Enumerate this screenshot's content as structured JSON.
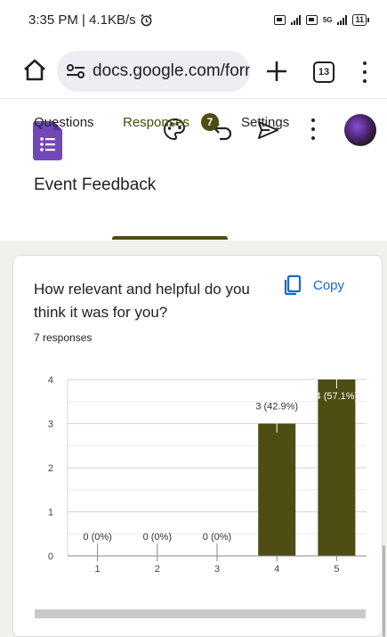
{
  "status_bar": {
    "time_speed": "3:35 PM | 4.1KB/s",
    "alarm_icon": "alarm-icon",
    "network_label": "5G",
    "battery": "11"
  },
  "browser": {
    "url": "docs.google.com/forr",
    "tab_count": "13",
    "icons": [
      "home-icon",
      "tune-icon",
      "plus-icon",
      "tabs-icon",
      "more-vert-icon"
    ]
  },
  "header": {
    "form_title": "Event Feedback",
    "icons": [
      "google-forms-icon",
      "palette-icon",
      "undo-icon",
      "send-icon",
      "more-vert-icon",
      "avatar"
    ],
    "tabs": [
      {
        "label": "Questions",
        "active": false
      },
      {
        "label": "Responses",
        "active": true
      },
      {
        "label": "Settings",
        "active": false
      }
    ],
    "responses_badge": "7",
    "accent_color": "#4d4d14"
  },
  "question_card": {
    "question": "How relevant and helpful do you think it was for you?",
    "copy_label": "Copy",
    "response_count": "7 responses"
  },
  "chart_data": {
    "type": "bar",
    "categories": [
      "1",
      "2",
      "3",
      "4",
      "5"
    ],
    "values": [
      0,
      0,
      0,
      3,
      4
    ],
    "data_labels": [
      "0 (0%)",
      "0 (0%)",
      "0 (0%)",
      "3 (42.9%)",
      "4 (57.1%)"
    ],
    "y_ticks": [
      "0",
      "1",
      "2",
      "3",
      "4"
    ],
    "ylim": [
      0,
      4
    ],
    "bar_color": "#4d4d14",
    "grid": true,
    "title": "",
    "xlabel": "",
    "ylabel": ""
  }
}
